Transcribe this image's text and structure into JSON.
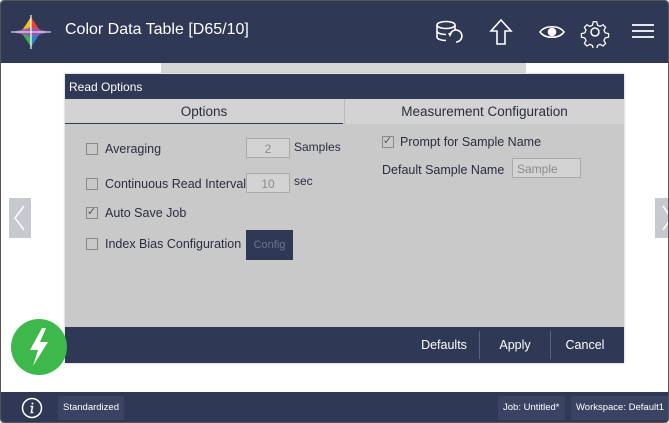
{
  "header": {
    "title": "Color Data Table [D65/10]",
    "icons": [
      "database-sync-icon",
      "upload-arrow-icon",
      "eye-icon",
      "gear-icon",
      "hamburger-menu-icon"
    ]
  },
  "dialog": {
    "title": "Read Options",
    "tabs": [
      {
        "label": "Options",
        "selected": true
      },
      {
        "label": "Measurement Configuration",
        "selected": false
      }
    ],
    "options": {
      "averaging": {
        "label": "Averaging",
        "checked": false,
        "value": "2",
        "unit": "Samples"
      },
      "continuous": {
        "label": "Continuous Read Interval",
        "checked": false,
        "value": "10",
        "unit": "sec"
      },
      "auto_save": {
        "label": "Auto Save Job",
        "checked": true
      },
      "index_bias": {
        "label": "Index Bias Configuration",
        "checked": false,
        "button": "Config"
      }
    },
    "measurement": {
      "prompt": {
        "label": "Prompt for Sample Name",
        "checked": true
      },
      "default_name": {
        "label": "Default Sample Name",
        "placeholder": "Sample"
      }
    },
    "footer": {
      "defaults": "Defaults",
      "apply": "Apply",
      "cancel": "Cancel"
    }
  },
  "statusbar": {
    "status": "Standardized",
    "job": "Job: Untitled*",
    "workspace": "Workspace: Default1"
  },
  "colors": {
    "navy": "#2f3854",
    "dialog_bg": "#c9c9c9",
    "accent_green": "#3db84a"
  }
}
